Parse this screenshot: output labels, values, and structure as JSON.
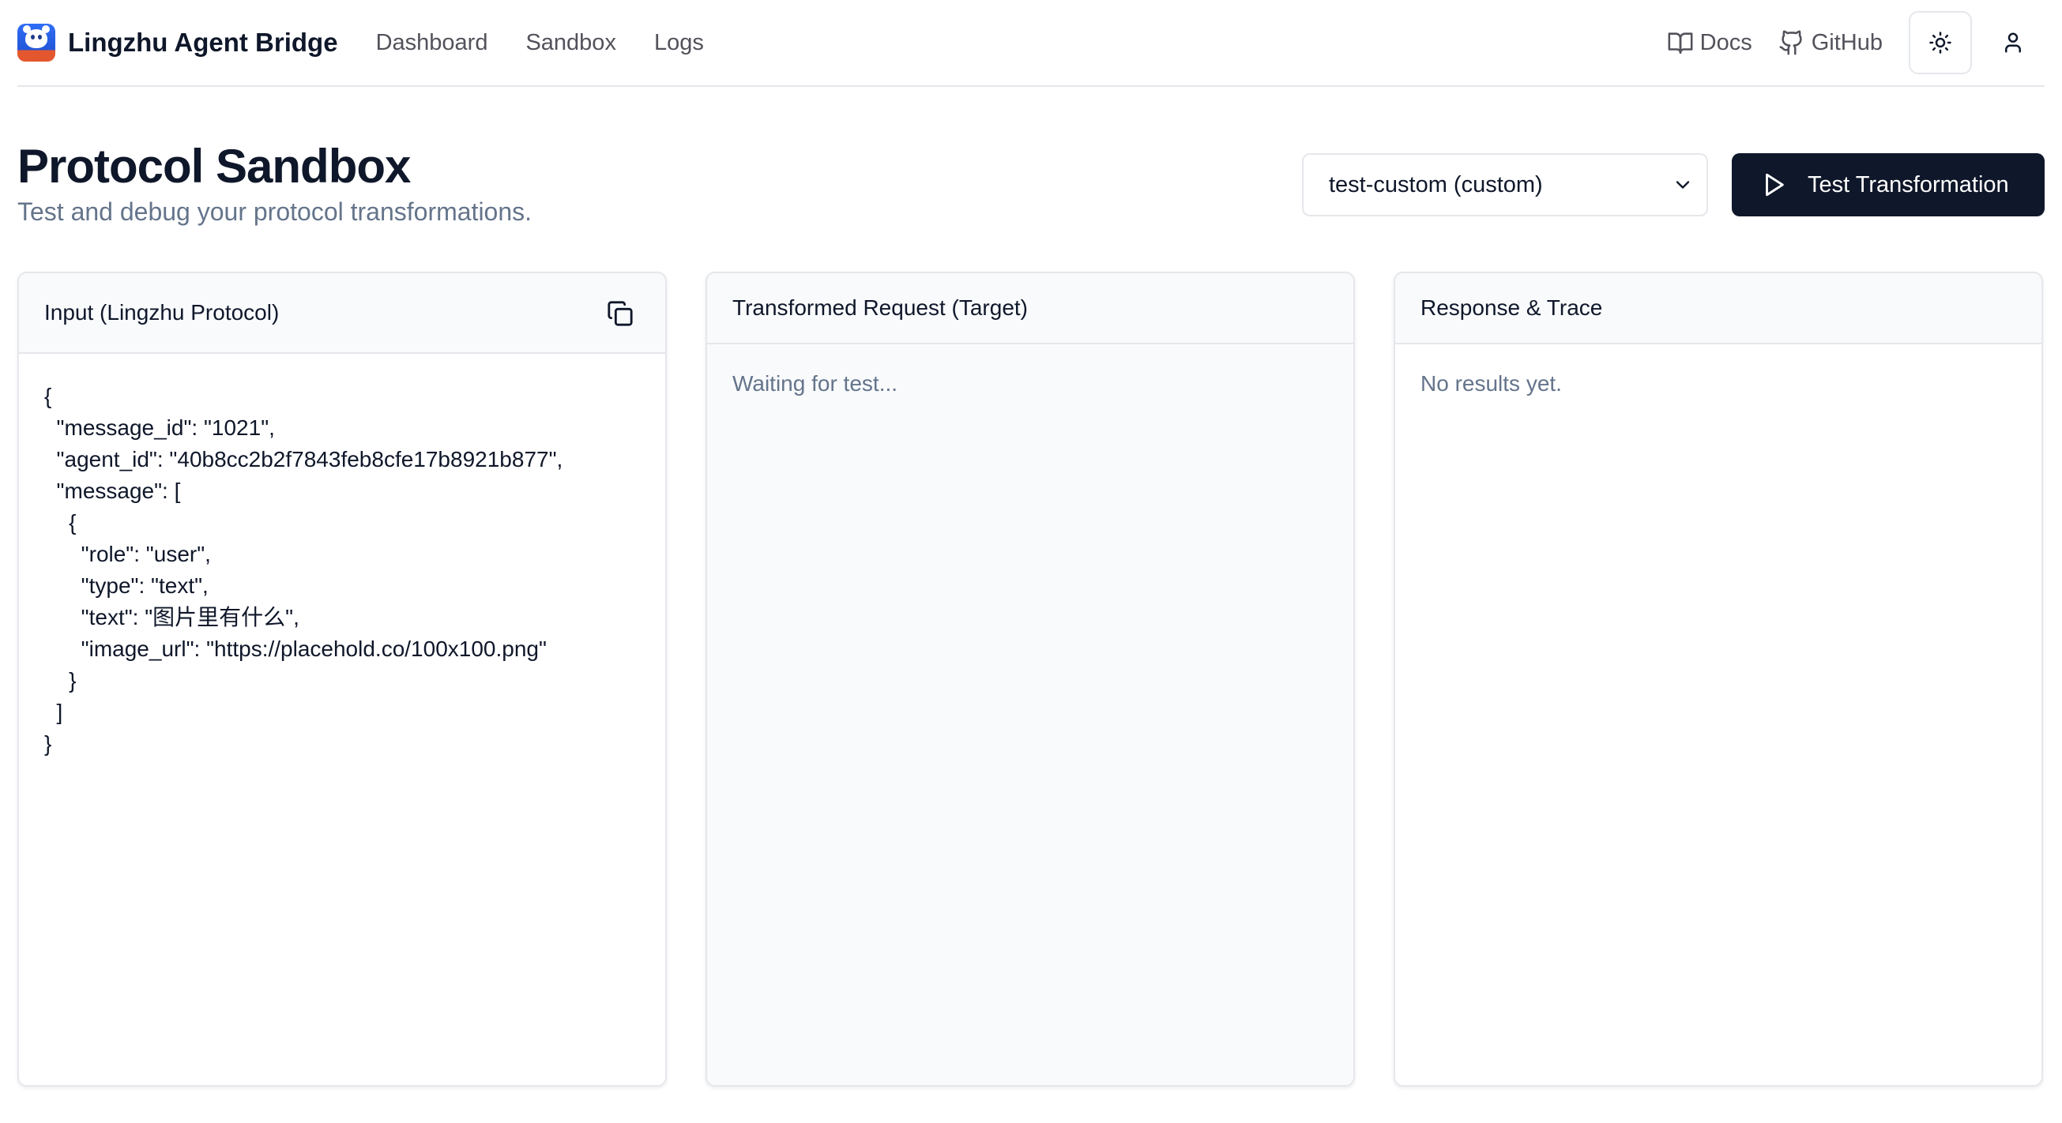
{
  "app": {
    "name": "Lingzhu Agent Bridge",
    "nav": [
      "Dashboard",
      "Sandbox",
      "Logs"
    ],
    "docs_label": "Docs",
    "github_label": "GitHub"
  },
  "page": {
    "title": "Protocol Sandbox",
    "subtitle": "Test and debug your protocol transformations.",
    "selected_target": "test-custom (custom)",
    "run_label": "Test Transformation"
  },
  "panels": {
    "input_title": "Input (Lingzhu Protocol)",
    "input_json": "{\n  \"message_id\": \"1021\",\n  \"agent_id\": \"40b8cc2b2f7843feb8cfe17b8921b877\",\n  \"message\": [\n    {\n      \"role\": \"user\",\n      \"type\": \"text\",\n      \"text\": \"图片里有什么\",\n      \"image_url\": \"https://placehold.co/100x100.png\"\n    }\n  ]\n}",
    "request_title": "Transformed Request (Target)",
    "request_placeholder": "Waiting for test...",
    "response_title": "Response & Trace",
    "response_placeholder": "No results yet."
  },
  "icons": {
    "brand": "lingzhu-logo-icon",
    "docs": "book-open-icon",
    "github": "github-icon",
    "theme": "sun-icon",
    "user": "user-icon",
    "select": "chevron-down-icon",
    "run": "play-icon",
    "copy": "copy-icon"
  },
  "colors": {
    "primary": "#0f172a",
    "muted_text": "#64748b",
    "border": "#e5e7eb",
    "panel_header": "#f8fafc"
  }
}
